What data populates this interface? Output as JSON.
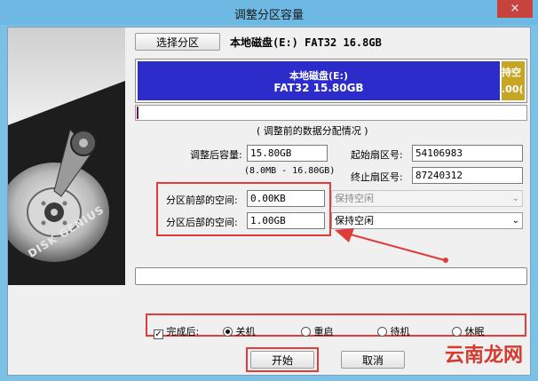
{
  "window": {
    "title": "调整分区容量",
    "close_symbol": "×"
  },
  "side_art": {
    "brand": "DISK GENIUS"
  },
  "toolbar": {
    "select_partition_label": "选择分区",
    "disk_info": "本地磁盘(E:) FAT32 16.8GB"
  },
  "partition_bar": {
    "main_line1": "本地磁盘(E:)",
    "main_line2": "FAT32 15.80GB",
    "free_line1": "持空",
    "free_line2": ".00("
  },
  "form": {
    "section_title": "( 调整前的数据分配情况 )",
    "size_after_label": "调整后容量:",
    "size_after_value": "15.80GB",
    "size_range": "(8.0MB - 16.80GB)",
    "start_sector_label": "起始扇区号:",
    "start_sector_value": "54106983",
    "end_sector_label": "终止扇区号:",
    "end_sector_value": "87240312",
    "space_before_label": "分区前部的空间:",
    "space_before_value": "0.00KB",
    "space_before_option": "保持空闲",
    "space_after_label": "分区后部的空间:",
    "space_after_value": "1.00GB",
    "space_after_option": "保持空闲"
  },
  "after_completion": {
    "checkbox_label": "完成后:",
    "checked": true,
    "options": [
      "关机",
      "重启",
      "待机",
      "休眠"
    ],
    "selected_index": 0
  },
  "buttons": {
    "start": "开始",
    "cancel": "取消"
  },
  "watermark": "云南龙网",
  "colors": {
    "titlebar": "#6db9e3",
    "partition_main": "#2c2ccb",
    "partition_free": "#c7a623",
    "highlight": "#e23b3b"
  }
}
